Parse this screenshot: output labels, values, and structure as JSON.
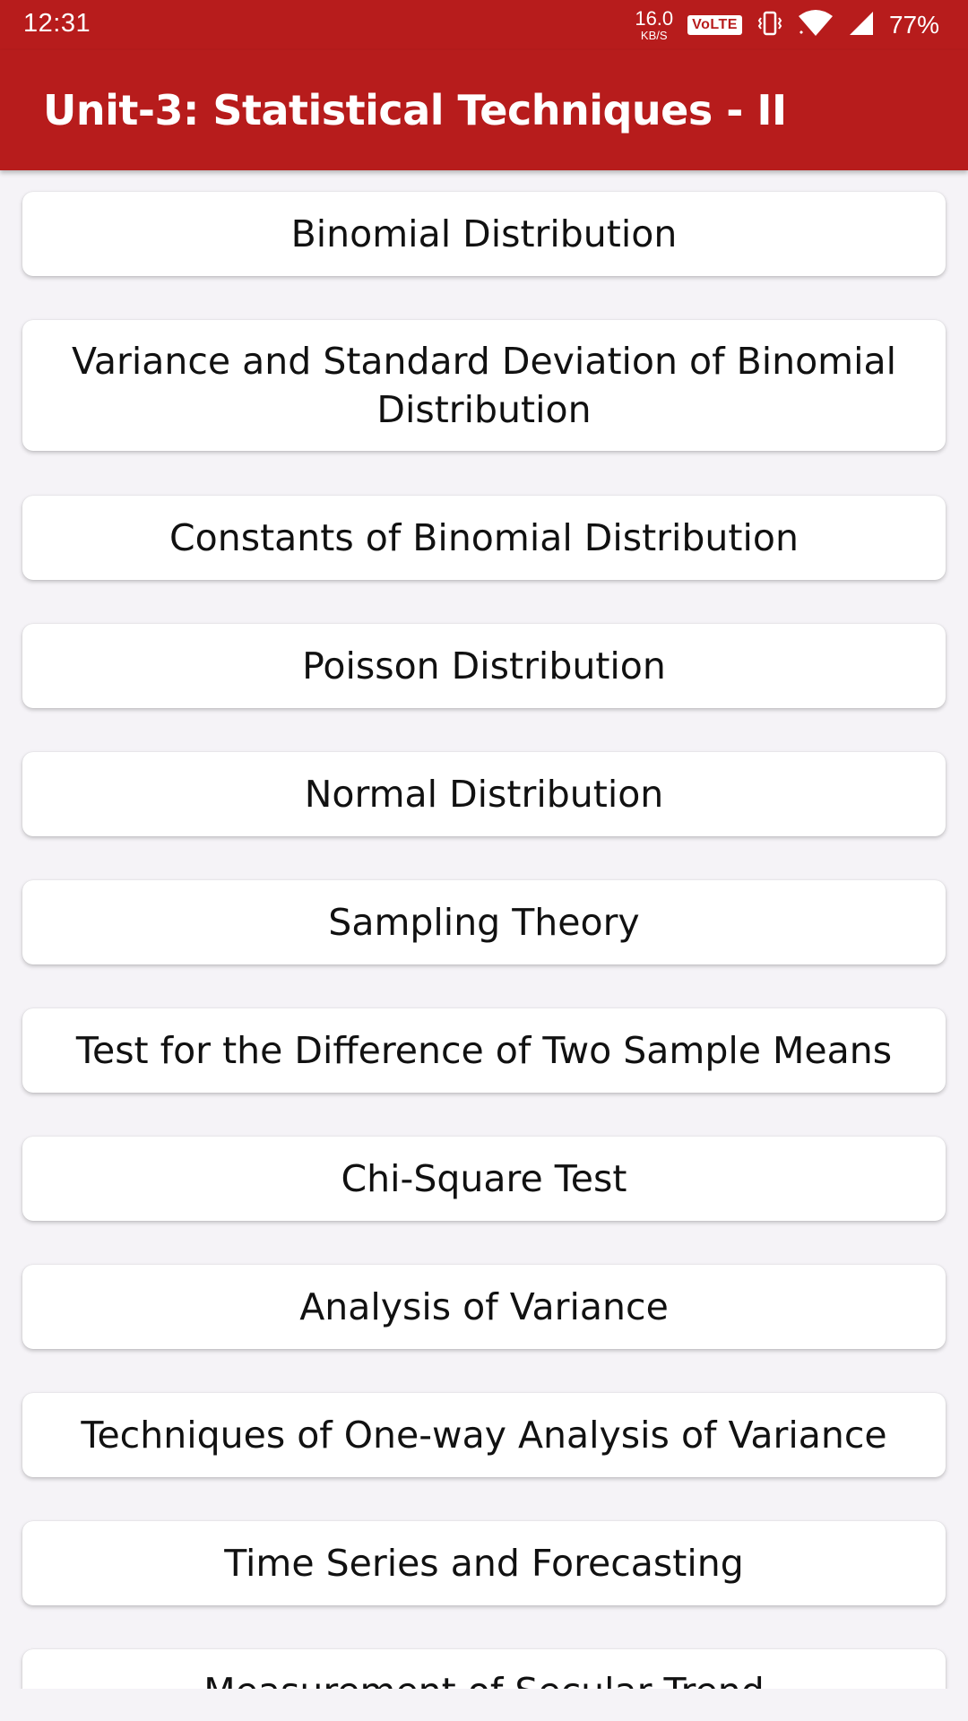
{
  "status_bar": {
    "time": "12:31",
    "net_speed_value": "16.0",
    "net_speed_unit": "KB/S",
    "volte": "VoLTE",
    "battery": "77%",
    "icons": [
      "vibrate-icon",
      "wifi-icon",
      "cell-signal-icon"
    ]
  },
  "app_bar": {
    "title": "Unit-3: Statistical Techniques - II",
    "color": "#b71c1c"
  },
  "topics": [
    "Binomial Distribution",
    "Variance and Standard Deviation of Binomial Distribution",
    "Constants of Binomial Distribution",
    "Poisson Distribution",
    "Normal Distribution",
    "Sampling Theory",
    "Test for the Difference of Two Sample Means",
    "Chi-Square Test",
    "Analysis of Variance",
    "Techniques of One-way Analysis of Variance",
    "Time Series and Forecasting",
    "Measurement of Secular Trend"
  ]
}
